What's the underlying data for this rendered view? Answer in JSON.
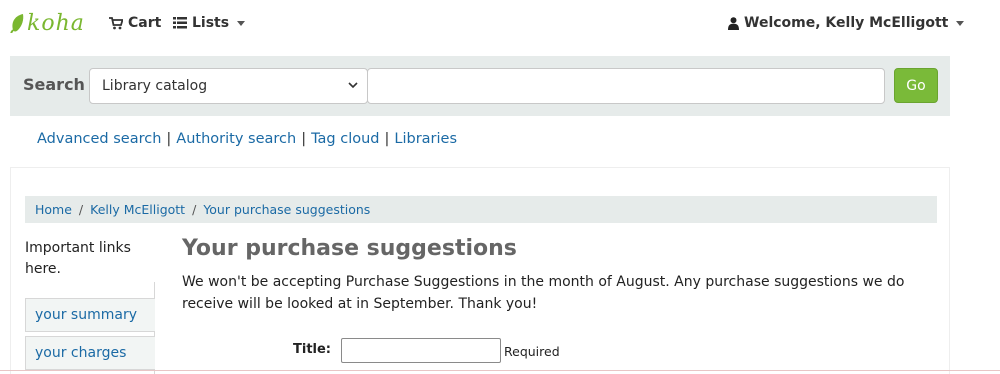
{
  "navbar": {
    "logo_text": "koha",
    "cart_label": "Cart",
    "lists_label": "Lists",
    "welcome_text": "Welcome, Kelly McElligott"
  },
  "search": {
    "label": "Search",
    "scope_selected": "Library catalog",
    "query_value": "",
    "go_label": "Go"
  },
  "more_searches": {
    "items": [
      "Advanced search",
      "Authority search",
      "Tag cloud",
      "Libraries"
    ],
    "separator": "|"
  },
  "breadcrumb": {
    "items": [
      "Home",
      "Kelly McElligott",
      "Your purchase suggestions"
    ],
    "separator": "/"
  },
  "sidebar": {
    "intro_text": "Important links here.",
    "items": [
      {
        "label": "your summary"
      },
      {
        "label": "your charges"
      }
    ]
  },
  "main": {
    "title": "Your purchase suggestions",
    "notice": "We won't be accepting Purchase Suggestions in the month of August.  Any purchase suggestions we do receive will be looked at in September.  Thank you!",
    "form": {
      "title_label": "Title:",
      "title_value": "",
      "required_text": "Required"
    }
  },
  "colors": {
    "brand_green": "#7ab730",
    "go_button": "#7aba39",
    "link_blue": "#1b6aa5",
    "searchbar_bg": "#e6ebea"
  },
  "icons": {
    "logo": "koha-leaf-icon",
    "cart": "cart-icon",
    "lists": "list-icon",
    "user": "user-icon",
    "dropdown": "caret-down-icon"
  }
}
